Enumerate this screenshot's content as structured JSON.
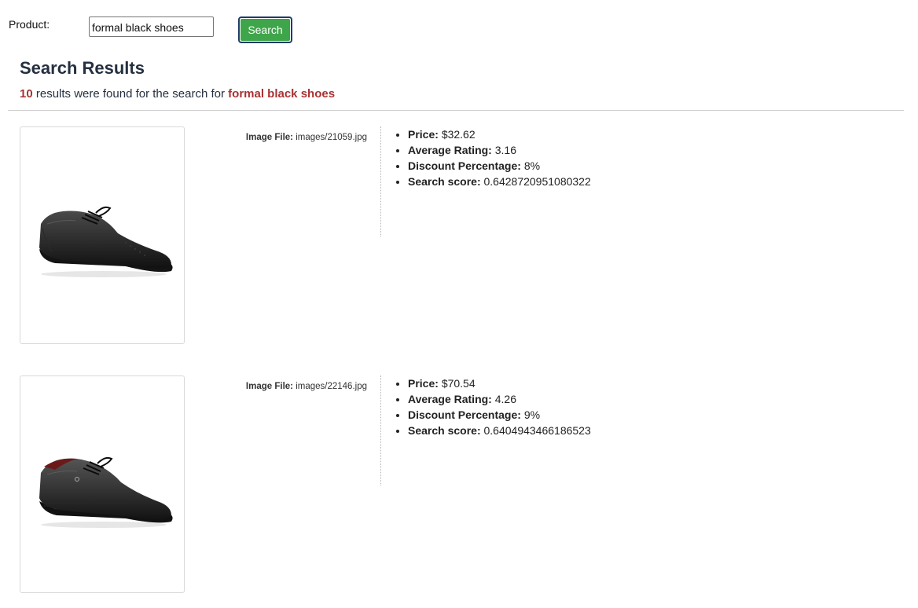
{
  "search": {
    "label": "Product:",
    "query": "formal black shoes",
    "button_label": "Search"
  },
  "results_header": {
    "title": "Search Results",
    "count": "10",
    "text_middle": "results were found for the search for",
    "query": "formal black shoes"
  },
  "fields": {
    "image_file": "Image File:",
    "price": "Price:",
    "rating": "Average Rating:",
    "discount": "Discount Percentage:",
    "score": "Search score:"
  },
  "results": [
    {
      "image_file": "images/21059.jpg",
      "price": "$32.62",
      "rating": "3.16",
      "discount": "8%",
      "score": "0.6428720951080322"
    },
    {
      "image_file": "images/22146.jpg",
      "price": "$70.54",
      "rating": "4.26",
      "discount": "9%",
      "score": "0.6404943466186523"
    }
  ],
  "icons": {
    "result_image": "shoe-photo"
  }
}
